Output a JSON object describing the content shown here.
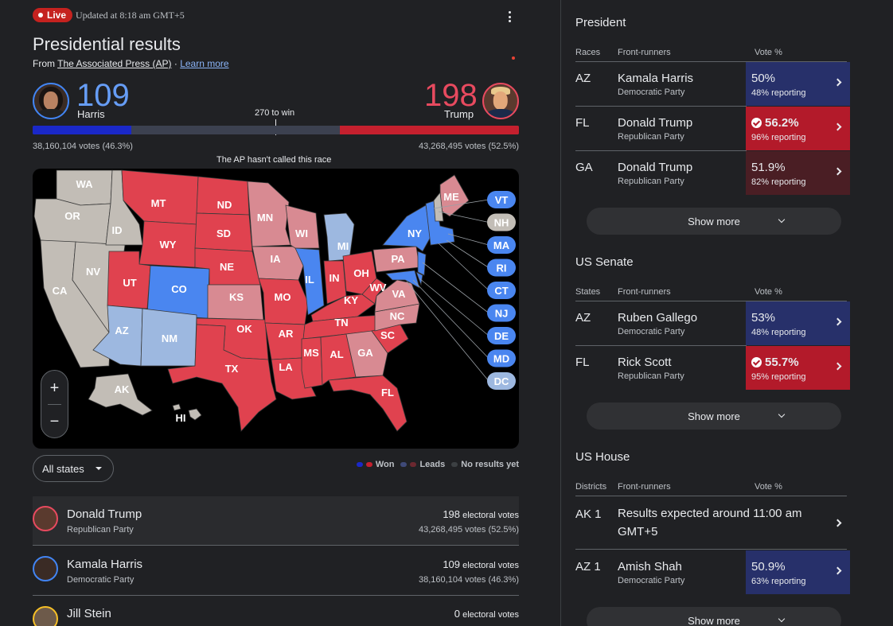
{
  "header": {
    "live_label": "Live",
    "updated": "Updated at 8:18 am GMT+5",
    "title": "Presidential results",
    "source_prefix": "From ",
    "source_name": "The Associated Press (AP)",
    "source_sep": " · ",
    "learn_more": "Learn more"
  },
  "tally": {
    "dem": {
      "name": "Harris",
      "ev": "109",
      "votes": "38,160,104 votes (46.3%)"
    },
    "rep": {
      "name": "Trump",
      "ev": "198",
      "votes": "43,268,495 votes (52.5%)"
    },
    "to_win": "270 to win",
    "not_called": "The AP hasn't called this race",
    "bar": {
      "total": 538,
      "dem_won": 109,
      "dem_lead": 0,
      "rep_won": 198,
      "rep_lead": 0
    }
  },
  "colors": {
    "dem_won": "#4a86f0",
    "dem_lead": "#9db8e0",
    "rep_won": "#e0424f",
    "rep_lead": "#d88a92",
    "no_results": "#c2bdb6",
    "map_bg": "#000000"
  },
  "map": {
    "state_labels": [
      "WA",
      "OR",
      "CA",
      "NV",
      "ID",
      "MT",
      "WY",
      "UT",
      "AZ",
      "CO",
      "NM",
      "ND",
      "SD",
      "NE",
      "KS",
      "OK",
      "TX",
      "MN",
      "IA",
      "MO",
      "AR",
      "LA",
      "WI",
      "IL",
      "MI",
      "IN",
      "KY",
      "TN",
      "MS",
      "AL",
      "GA",
      "FL",
      "SC",
      "NC",
      "VA",
      "WV",
      "OH",
      "PA",
      "NY",
      "ME",
      "AK",
      "HI"
    ],
    "bubbles": [
      "VT",
      "NH",
      "MA",
      "RI",
      "CT",
      "NJ",
      "DE",
      "MD",
      "DC"
    ],
    "zoom_in": "+",
    "zoom_out": "−"
  },
  "controls": {
    "filter_label": "All states",
    "legend_won": "Won",
    "legend_leads": "Leads",
    "legend_none": "No results yet"
  },
  "candidates": [
    {
      "name": "Donald Trump",
      "party": "Republican Party",
      "ev": "198",
      "ev_suffix": " electoral votes",
      "votes": "43,268,495 votes (52.5%)"
    },
    {
      "name": "Kamala Harris",
      "party": "Democratic Party",
      "ev": "109",
      "ev_suffix": " electoral votes",
      "votes": "38,160,104 votes (46.3%)"
    },
    {
      "name": "Jill Stein",
      "party": "",
      "ev": "0",
      "ev_suffix": " electoral votes",
      "votes": ""
    }
  ],
  "president": {
    "title": "President",
    "col_races": "Races",
    "col_front": "Front-runners",
    "col_vote": "Vote %",
    "rows": [
      {
        "code": "AZ",
        "name": "Kamala Harris",
        "party": "Democratic Party",
        "pct": "50%",
        "reporting": "48% reporting",
        "called": false
      },
      {
        "code": "FL",
        "name": "Donald Trump",
        "party": "Republican Party",
        "pct": "56.2%",
        "reporting": "96% reporting",
        "called": true
      },
      {
        "code": "GA",
        "name": "Donald Trump",
        "party": "Republican Party",
        "pct": "51.9%",
        "reporting": "82% reporting",
        "called": false
      }
    ],
    "show_more": "Show more"
  },
  "senate": {
    "title": "US Senate",
    "col_states": "States",
    "col_front": "Front-runners",
    "col_vote": "Vote %",
    "rows": [
      {
        "code": "AZ",
        "name": "Ruben Gallego",
        "party": "Democratic Party",
        "pct": "53%",
        "reporting": "48% reporting",
        "called": false
      },
      {
        "code": "FL",
        "name": "Rick Scott",
        "party": "Republican Party",
        "pct": "55.7%",
        "reporting": "95% reporting",
        "called": true
      }
    ],
    "show_more": "Show more"
  },
  "house": {
    "title": "US House",
    "col_districts": "Districts",
    "col_front": "Front-runners",
    "col_vote": "Vote %",
    "rows": [
      {
        "code": "AK 1",
        "message": "Results expected around 11:00 am GMT+5"
      },
      {
        "code": "AZ 1",
        "name": "Amish Shah",
        "party": "Democratic Party",
        "pct": "50.9%",
        "reporting": "63% reporting",
        "called": false
      }
    ],
    "show_more": "Show more"
  }
}
